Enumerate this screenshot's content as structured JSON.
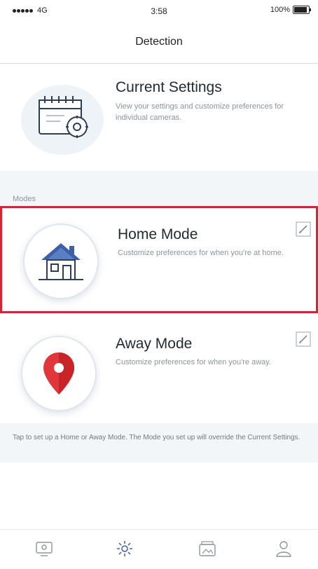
{
  "status_bar": {
    "carrier": "4G",
    "time": "3:58",
    "battery": "100%",
    "battery_level": 1.0
  },
  "nav": {
    "title": "Detection"
  },
  "current_settings": {
    "title": "Current Settings",
    "description": "View your settings and customize preferences for individual cameras.",
    "icon": "calendar-settings-icon"
  },
  "modes": {
    "label": "Modes",
    "items": [
      {
        "title": "Home Mode",
        "description": "Customize preferences for when you're at home.",
        "icon": "house-icon",
        "edit_icon": "edit-icon",
        "selected": true
      },
      {
        "title": "Away Mode",
        "description": "Customize preferences for when you're away.",
        "icon": "map-pin-icon",
        "edit_icon": "edit-icon",
        "selected": false
      }
    ]
  },
  "note": {
    "text": "Tap to set up a Home or Away Mode. The Mode you set up will override the Current Settings."
  },
  "tab_bar": {
    "tabs": [
      {
        "icon": "camera-icon"
      },
      {
        "icon": "detection-icon",
        "active": true
      },
      {
        "icon": "library-icon"
      },
      {
        "icon": "profile-icon"
      }
    ]
  },
  "colors": {
    "accent_red": "#c92a35",
    "pin_red": "#e0373c",
    "roof_blue": "#3d5fa8",
    "text_secondary": "#8b959c",
    "band_gray": "#f3f6f8"
  }
}
